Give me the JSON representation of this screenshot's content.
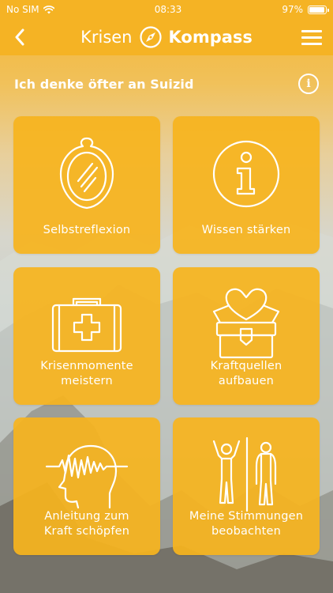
{
  "status_bar": {
    "carrier": "No SIM",
    "time": "08:33",
    "battery": "97%",
    "battery_level": 0.97
  },
  "nav": {
    "brand_part1": "Krisen",
    "brand_part2": "Kompass"
  },
  "page": {
    "heading": "Ich denke öfter an Suizid",
    "info_glyph": "i"
  },
  "tiles": [
    {
      "label": "Selbstreflexion",
      "icon": "mirror-icon"
    },
    {
      "label": "Wissen stärken",
      "icon": "info-icon"
    },
    {
      "label": "Krisenmomente\nmeistern",
      "icon": "first-aid-kit-icon"
    },
    {
      "label": "Kraftquellen\naufbauen",
      "icon": "heart-chest-icon"
    },
    {
      "label": "Anleitung zum\nKraft schöpfen",
      "icon": "head-waves-icon"
    },
    {
      "label": "Meine Stimmungen\nbeobachten",
      "icon": "mood-figures-icon"
    }
  ],
  "colors": {
    "accent": "#f5b324",
    "tile": "#f6b41e",
    "text": "#ffffff"
  }
}
